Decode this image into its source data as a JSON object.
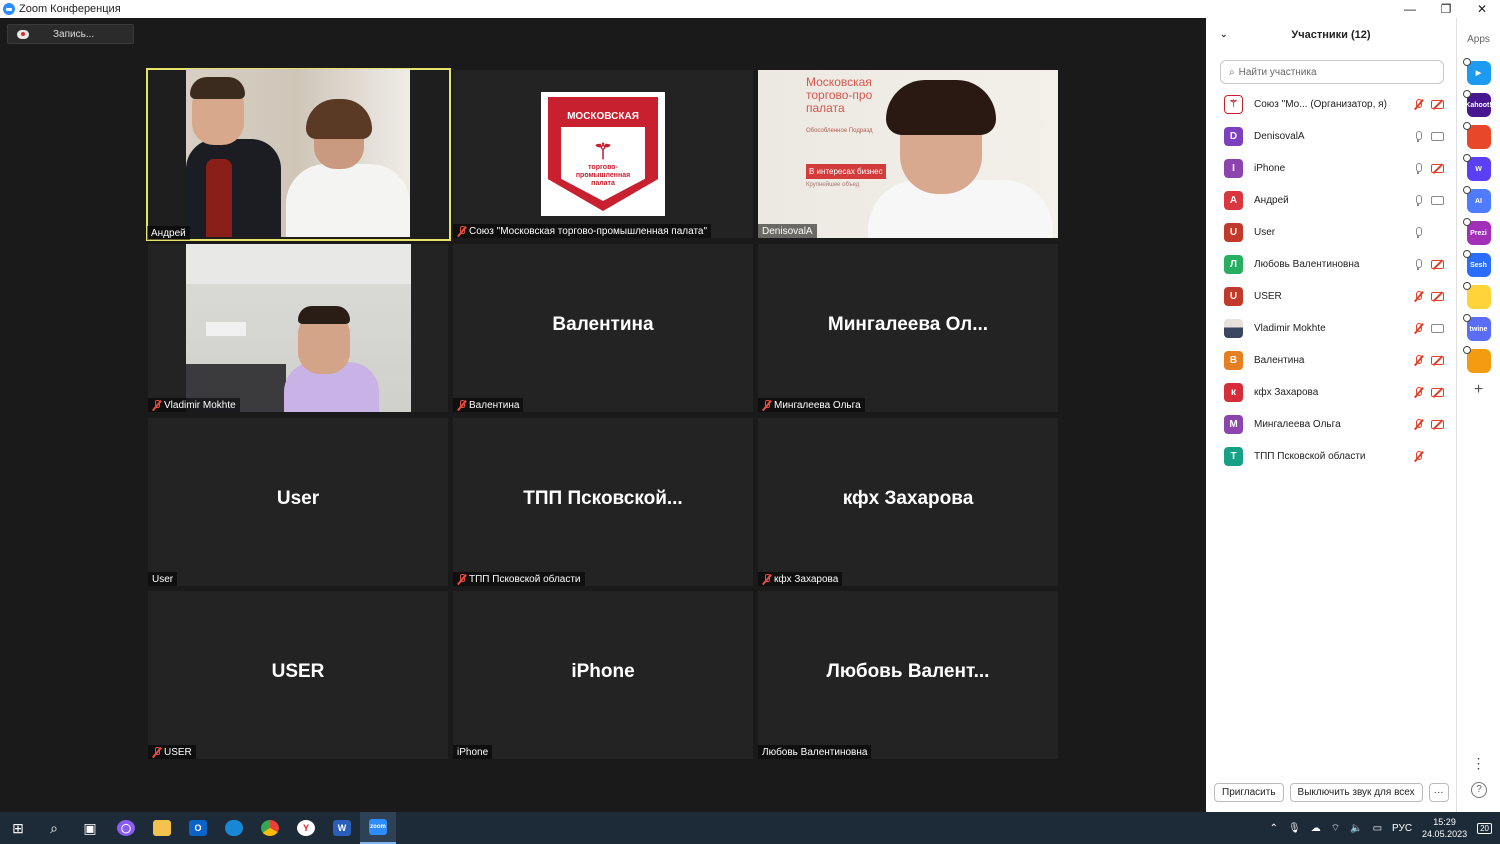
{
  "window": {
    "title": "Zoom Конференция",
    "minimize": "—",
    "restore": "❐",
    "close": "✕"
  },
  "recording": {
    "label": "Запись..."
  },
  "tiles": [
    {
      "label": "Андрей",
      "muted": false,
      "big": ""
    },
    {
      "label": "Союз \"Московская торгово-промышленная палата\"",
      "muted": true,
      "big": ""
    },
    {
      "label": "DenisovalA",
      "muted": false,
      "big": ""
    },
    {
      "label": "Vladimir Mokhte",
      "muted": true,
      "big": ""
    },
    {
      "label": "Валентина",
      "muted": true,
      "big": "Валентина"
    },
    {
      "label": "Мингалеева Ольга",
      "muted": true,
      "big": "Мингалеева  Ол..."
    },
    {
      "label": "User",
      "muted": false,
      "big": "User"
    },
    {
      "label": "ТПП Псковской области",
      "muted": true,
      "big": "ТПП  Псковской..."
    },
    {
      "label": "кфх Захарова",
      "muted": true,
      "big": "кфх Захарова"
    },
    {
      "label": "USER",
      "muted": true,
      "big": "USER"
    },
    {
      "label": "iPhone",
      "muted": false,
      "big": "iPhone"
    },
    {
      "label": "Любовь Валентиновна",
      "muted": false,
      "big": "Любовь  Валент..."
    }
  ],
  "logo": {
    "top": "МОСКОВСКАЯ",
    "line1": "торгово-",
    "line2": "промышленная",
    "line3": "палата"
  },
  "slide_text": {
    "l1": "Московская",
    "l2": "торгово-про",
    "l3": "палата",
    "l4": "Обособленное Подразд",
    "l5": "В интересах бизнес",
    "l6": "Крупнейшее объед"
  },
  "panel": {
    "title": "Участники (12)",
    "search_placeholder": "Найти участника",
    "participants": [
      {
        "initial": "",
        "name": "Союз \"Мо... (Организатор, я)",
        "color": "#ffffff",
        "mic": "off",
        "cam": "off"
      },
      {
        "initial": "D",
        "name": "DenisovalA",
        "color": "#7b3fbf",
        "mic": "on",
        "cam": "on"
      },
      {
        "initial": "I",
        "name": "iPhone",
        "color": "#8e44ad",
        "mic": "on",
        "cam": "off"
      },
      {
        "initial": "А",
        "name": "Андрей",
        "color": "#d9363e",
        "mic": "on",
        "cam": "on"
      },
      {
        "initial": "U",
        "name": "User",
        "color": "#c0392b",
        "mic": "on",
        "cam": "none"
      },
      {
        "initial": "Л",
        "name": "Любовь Валентиновна",
        "color": "#27ae60",
        "mic": "on",
        "cam": "off"
      },
      {
        "initial": "U",
        "name": "USER",
        "color": "#c0392b",
        "mic": "off",
        "cam": "off"
      },
      {
        "initial": "",
        "name": "Vladimir Mokhte",
        "color": "#6b8fb5",
        "mic": "off",
        "cam": "on"
      },
      {
        "initial": "В",
        "name": "Валентина",
        "color": "#e67e22",
        "mic": "off",
        "cam": "off"
      },
      {
        "initial": "к",
        "name": "кфх Захарова",
        "color": "#d62d3a",
        "mic": "off",
        "cam": "off"
      },
      {
        "initial": "M",
        "name": "Мингалеева Ольга",
        "color": "#8e44ad",
        "mic": "off",
        "cam": "off"
      },
      {
        "initial": "Т",
        "name": "ТПП Псковской области",
        "color": "#16a085",
        "mic": "off",
        "cam": "none"
      }
    ],
    "invite": "Пригласить",
    "mute_all": "Выключить звук для всех",
    "more": "···"
  },
  "apps": {
    "title": "Apps",
    "items": [
      {
        "name": "Kahoot!",
        "color": "#46178f"
      },
      {
        "name": "",
        "color": "#e8472a"
      },
      {
        "name": "W",
        "color": "#5a3ff5"
      },
      {
        "name": "AI",
        "color": "#4f7cff"
      },
      {
        "name": "Prezi",
        "color": "#a12fb8"
      },
      {
        "name": "Sesh",
        "color": "#2b6dff"
      },
      {
        "name": "",
        "color": "#ffd43b"
      },
      {
        "name": "twine",
        "color": "#5b6cf6"
      },
      {
        "name": "",
        "color": "#f39c12"
      }
    ],
    "add": "+",
    "menu": "⋮",
    "help": "?"
  },
  "taskbar": {
    "lang": "РУС",
    "time": "15:29",
    "date": "24.05.2023",
    "notif": "20"
  }
}
